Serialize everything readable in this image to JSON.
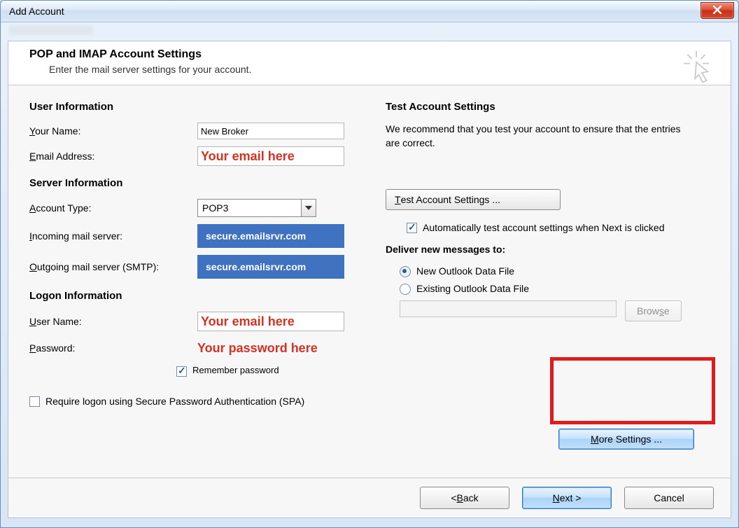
{
  "window": {
    "title": "Add Account",
    "close_tooltip": "Close"
  },
  "header": {
    "title": "POP and IMAP Account Settings",
    "subtitle": "Enter the mail server settings for your account."
  },
  "left": {
    "user_info_heading": "User Information",
    "your_name_label_pre": "Y",
    "your_name_label_rest": "our Name:",
    "your_name_value": "New Broker",
    "email_label_pre": "E",
    "email_label_rest": "mail Address:",
    "email_value": "Your email here",
    "server_info_heading": "Server Information",
    "account_type_label_pre": "A",
    "account_type_label_rest": "ccount Type:",
    "account_type_value": "POP3",
    "incoming_label_pre": "I",
    "incoming_label_rest": "ncoming mail server:",
    "incoming_value": "secure.emailsrvr.com",
    "outgoing_label_pre": "O",
    "outgoing_label_rest": "utgoing mail server (SMTP):",
    "outgoing_value": "secure.emailsrvr.com",
    "logon_heading": "Logon Information",
    "username_label_pre": "U",
    "username_label_rest": "ser Name:",
    "username_value": "Your email here",
    "password_label_pre": "P",
    "password_label_rest": "assword:",
    "password_value": "Your password here",
    "remember_pre": "R",
    "remember_rest": "emember password",
    "spa_label_pre": "Re",
    "spa_label_underline": "q",
    "spa_label_rest": "uire logon using Secure Password Authentication (SPA)"
  },
  "right": {
    "test_heading": "Test Account Settings",
    "test_text": "We recommend that you test your account to ensure that the entries are correct.",
    "test_button_pre": "T",
    "test_button_rest": "est Account Settings ...",
    "auto_test_pre": "Automatically test account ",
    "auto_test_u": "s",
    "auto_test_rest": "ettings when Next is clicked",
    "deliver_heading": "Deliver new messages to:",
    "radio1_pre": "Ne",
    "radio1_u": "w",
    "radio1_rest": " Outlook Data File",
    "radio2_pre": "E",
    "radio2_u": "x",
    "radio2_rest": "isting Outlook Data File",
    "browse_label_pre": "Brow",
    "browse_label_u": "s",
    "browse_label_rest": "e",
    "more_settings_pre": "M",
    "more_settings_rest": "ore Settings ..."
  },
  "footer": {
    "back_pre": "< ",
    "back_u": "B",
    "back_rest": "ack",
    "next_pre": "N",
    "next_rest": "ext >",
    "cancel": "Cancel"
  }
}
